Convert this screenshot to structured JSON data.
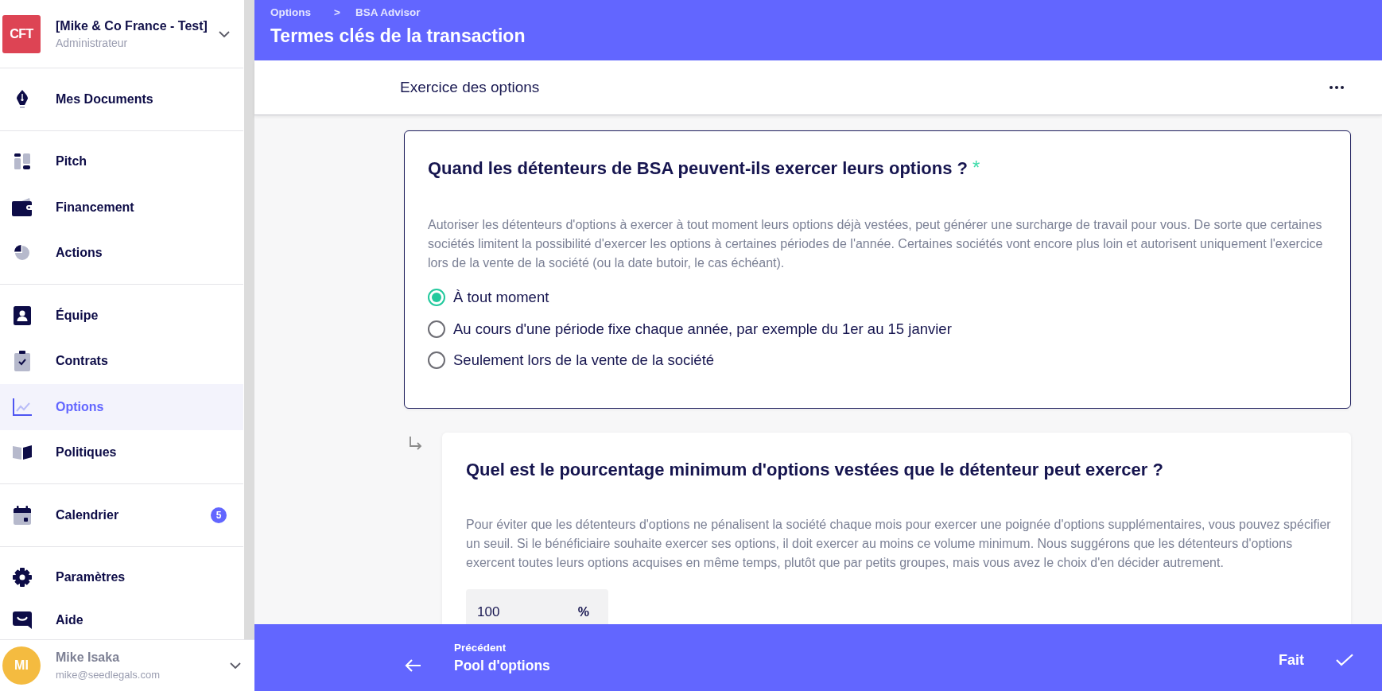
{
  "sidebar": {
    "organization": {
      "initials": "CFT",
      "name": "[Mike & Co France - Test]",
      "role": "Administrateur"
    },
    "nav_groups": [
      {
        "items": [
          {
            "label": "Mes Documents",
            "selected": false
          }
        ]
      },
      {
        "items": [
          {
            "label": "Pitch",
            "selected": false
          },
          {
            "label": "Financement",
            "selected": false
          },
          {
            "label": "Actions",
            "selected": false
          }
        ]
      },
      {
        "items": [
          {
            "label": "Équipe",
            "selected": false
          },
          {
            "label": "Contrats",
            "selected": false
          },
          {
            "label": "Options",
            "selected": true
          },
          {
            "label": "Politiques",
            "selected": false
          }
        ]
      },
      {
        "items": [
          {
            "label": "Calendrier",
            "selected": false,
            "badge": "5"
          }
        ]
      },
      {
        "items": [
          {
            "label": "Paramètres",
            "selected": false
          },
          {
            "label": "Aide",
            "selected": false
          }
        ]
      }
    ],
    "user": {
      "initials": "MI",
      "name": "Mike Isaka",
      "email": "mike@seedlegals.com"
    }
  },
  "header": {
    "breadcrumb": {
      "items": [
        "Options",
        "BSA Advisor"
      ],
      "separator": ">"
    },
    "title": "Termes clés de la transaction"
  },
  "section_bar": {
    "title": "Exercice des options"
  },
  "questions": [
    {
      "kind": "choice",
      "follow_up": false,
      "title": "Quand les détenteurs de BSA peuvent-ils exercer leurs options ?",
      "required_mark": "*",
      "description": "Autoriser les détenteurs d'options à exercer à tout moment leurs options déjà vestées, peut générer une surcharge de travail pour vous. De sorte que certaines sociétés limitent la possibilité d'exercer les options à certaines périodes de l'année. Certaines sociétés vont encore plus loin et autorisent uniquement l'exercice lors de la vente de la société (ou la date butoir, le cas échéant).",
      "options": [
        {
          "label": "À tout moment",
          "selected": true
        },
        {
          "label": "Au cours d'une période fixe chaque année, par exemple du 1er au 15 janvier",
          "selected": false
        },
        {
          "label": "Seulement lors de la vente de la société",
          "selected": false
        }
      ]
    },
    {
      "kind": "number",
      "follow_up": true,
      "title": "Quel est le pourcentage minimum d'options vestées que le détenteur peut exercer ?",
      "description": "Pour éviter que les détenteurs d'options ne pénalisent la société chaque mois pour exercer une poignée d'options supplémentaires, vous pouvez spécifier un seuil. Si le bénéficiaire souhaite exercer ses options, il doit exercer au moins ce volume minimum. Nous suggérons que les détenteurs d'options exercent toutes leurs options acquises en même temps, plutôt que par petits groupes, mais vous avez le choix d'en décider autrement.",
      "value": "100",
      "unit": "%"
    }
  ],
  "footer": {
    "previous": {
      "label": "Précédent",
      "title": "Pool d'options"
    },
    "done": {
      "label": "Fait"
    }
  }
}
